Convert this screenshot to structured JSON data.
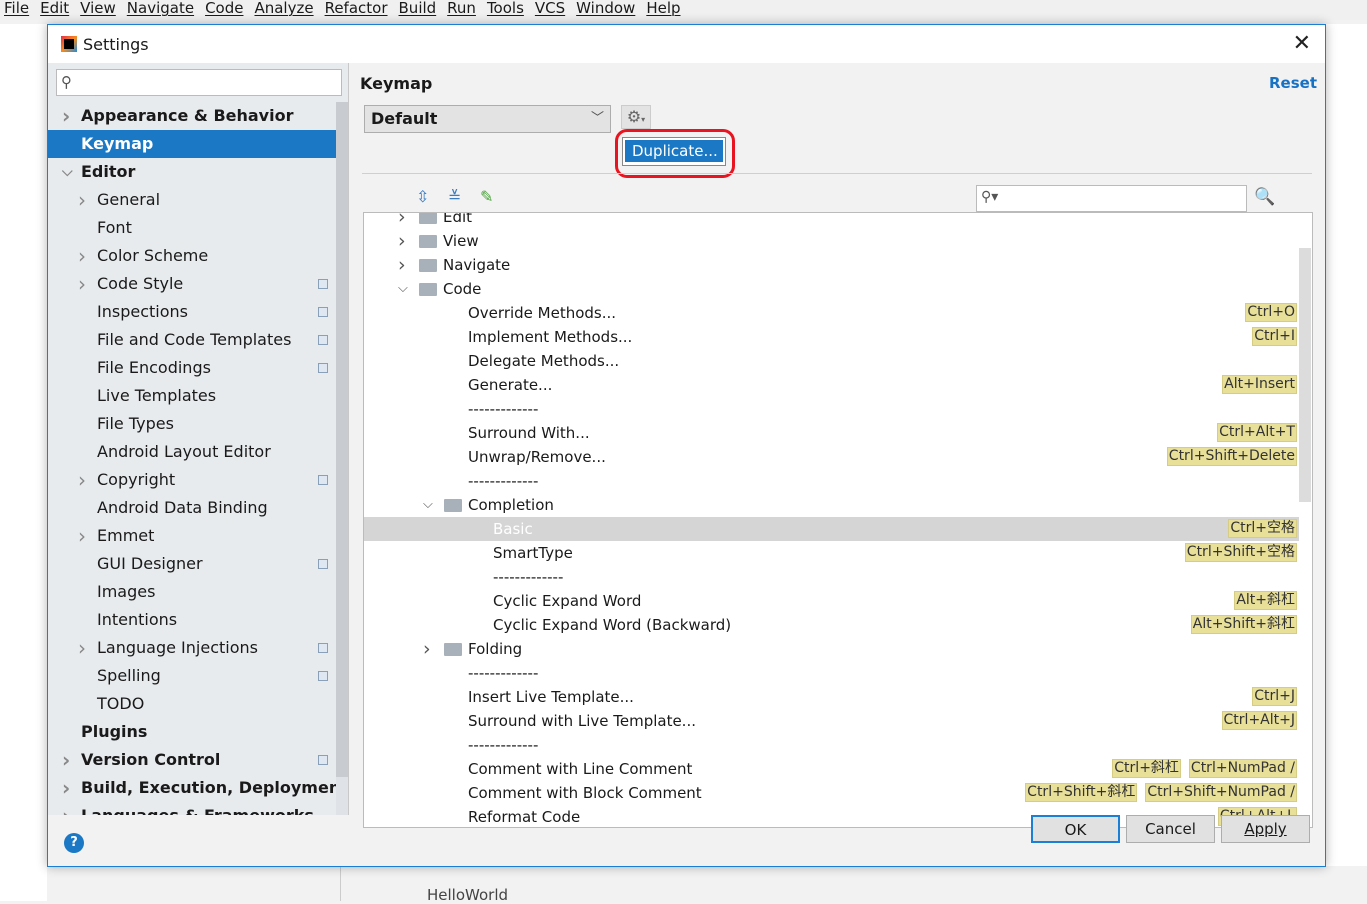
{
  "menubar": [
    "File",
    "Edit",
    "View",
    "Navigate",
    "Code",
    "Analyze",
    "Refactor",
    "Build",
    "Run",
    "Tools",
    "VCS",
    "Window",
    "Help"
  ],
  "ide": {
    "bottom_tab": "HelloWorld"
  },
  "dialog": {
    "title": "Settings",
    "search": {
      "value": "",
      "placeholder": ""
    },
    "sidebar": [
      {
        "label": "Appearance & Behavior",
        "level": 0,
        "bold": true,
        "chevron": "right"
      },
      {
        "label": "Keymap",
        "level": 0,
        "bold": true,
        "selected": true
      },
      {
        "label": "Editor",
        "level": 0,
        "bold": true,
        "chevron": "down"
      },
      {
        "label": "General",
        "level": 1,
        "chevron": "right"
      },
      {
        "label": "Font",
        "level": 1
      },
      {
        "label": "Color Scheme",
        "level": 1,
        "chevron": "right"
      },
      {
        "label": "Code Style",
        "level": 1,
        "chevron": "right",
        "project": true
      },
      {
        "label": "Inspections",
        "level": 1,
        "project": true
      },
      {
        "label": "File and Code Templates",
        "level": 1,
        "project": true
      },
      {
        "label": "File Encodings",
        "level": 1,
        "project": true
      },
      {
        "label": "Live Templates",
        "level": 1
      },
      {
        "label": "File Types",
        "level": 1
      },
      {
        "label": "Android Layout Editor",
        "level": 1
      },
      {
        "label": "Copyright",
        "level": 1,
        "chevron": "right",
        "project": true
      },
      {
        "label": "Android Data Binding",
        "level": 1
      },
      {
        "label": "Emmet",
        "level": 1,
        "chevron": "right"
      },
      {
        "label": "GUI Designer",
        "level": 1,
        "project": true
      },
      {
        "label": "Images",
        "level": 1
      },
      {
        "label": "Intentions",
        "level": 1
      },
      {
        "label": "Language Injections",
        "level": 1,
        "chevron": "right",
        "project": true
      },
      {
        "label": "Spelling",
        "level": 1,
        "project": true
      },
      {
        "label": "TODO",
        "level": 1
      },
      {
        "label": "Plugins",
        "level": 0,
        "bold": true
      },
      {
        "label": "Version Control",
        "level": 0,
        "bold": true,
        "chevron": "right",
        "project": true
      },
      {
        "label": "Build, Execution, Deployment",
        "level": 0,
        "bold": true,
        "chevron": "right"
      },
      {
        "label": "Languages & Frameworks",
        "level": 0,
        "bold": true,
        "chevron": "right"
      }
    ],
    "keymap": {
      "title": "Keymap",
      "reset": "Reset",
      "scheme": "Default",
      "gear_menu": {
        "item": "Duplicate..."
      },
      "search": {
        "value": "",
        "placeholder": ""
      },
      "tree": [
        {
          "label": "Edit",
          "level": 0,
          "folder": true,
          "chevron": "right"
        },
        {
          "label": "View",
          "level": 0,
          "folder": true,
          "chevron": "right"
        },
        {
          "label": "Navigate",
          "level": 0,
          "folder": true,
          "chevron": "right"
        },
        {
          "label": "Code",
          "level": 0,
          "folder": true,
          "chevron": "down"
        },
        {
          "label": "Override Methods...",
          "level": 1,
          "keys": [
            "Ctrl+O"
          ]
        },
        {
          "label": "Implement Methods...",
          "level": 1,
          "keys": [
            "Ctrl+I"
          ]
        },
        {
          "label": "Delegate Methods...",
          "level": 1,
          "keys": []
        },
        {
          "label": "Generate...",
          "level": 1,
          "keys": [
            "Alt+Insert"
          ]
        },
        {
          "label": "-------------",
          "level": 1,
          "keys": []
        },
        {
          "label": "Surround With...",
          "level": 1,
          "keys": [
            "Ctrl+Alt+T"
          ]
        },
        {
          "label": "Unwrap/Remove...",
          "level": 1,
          "keys": [
            "Ctrl+Shift+Delete"
          ]
        },
        {
          "label": "-------------",
          "level": 1,
          "keys": []
        },
        {
          "label": "Completion",
          "level": 1,
          "folder": true,
          "chevron": "down"
        },
        {
          "label": "Basic",
          "level": 2,
          "keys": [
            "Ctrl+空格"
          ],
          "selected": true
        },
        {
          "label": "SmartType",
          "level": 2,
          "keys": [
            "Ctrl+Shift+空格"
          ]
        },
        {
          "label": "-------------",
          "level": 2,
          "keys": []
        },
        {
          "label": "Cyclic Expand Word",
          "level": 2,
          "keys": [
            "Alt+斜杠"
          ]
        },
        {
          "label": "Cyclic Expand Word (Backward)",
          "level": 2,
          "keys": [
            "Alt+Shift+斜杠"
          ]
        },
        {
          "label": "Folding",
          "level": 1,
          "folder": true,
          "chevron": "right"
        },
        {
          "label": "-------------",
          "level": 1,
          "keys": []
        },
        {
          "label": "Insert Live Template...",
          "level": 1,
          "keys": [
            "Ctrl+J"
          ]
        },
        {
          "label": "Surround with Live Template...",
          "level": 1,
          "keys": [
            "Ctrl+Alt+J"
          ]
        },
        {
          "label": "-------------",
          "level": 1,
          "keys": []
        },
        {
          "label": "Comment with Line Comment",
          "level": 1,
          "keys": [
            "Ctrl+斜杠",
            "Ctrl+NumPad /"
          ]
        },
        {
          "label": "Comment with Block Comment",
          "level": 1,
          "keys": [
            "Ctrl+Shift+斜杠",
            "Ctrl+Shift+NumPad /"
          ]
        },
        {
          "label": "Reformat Code",
          "level": 1,
          "keys": [
            "Ctrl+Alt+L"
          ]
        }
      ]
    },
    "buttons": {
      "ok": "OK",
      "cancel": "Cancel",
      "apply": "Apply"
    },
    "colors": {
      "accent": "#1b78c4",
      "shortcut_bg": "#e8df98",
      "highlight_ring": "#e8141f"
    }
  }
}
